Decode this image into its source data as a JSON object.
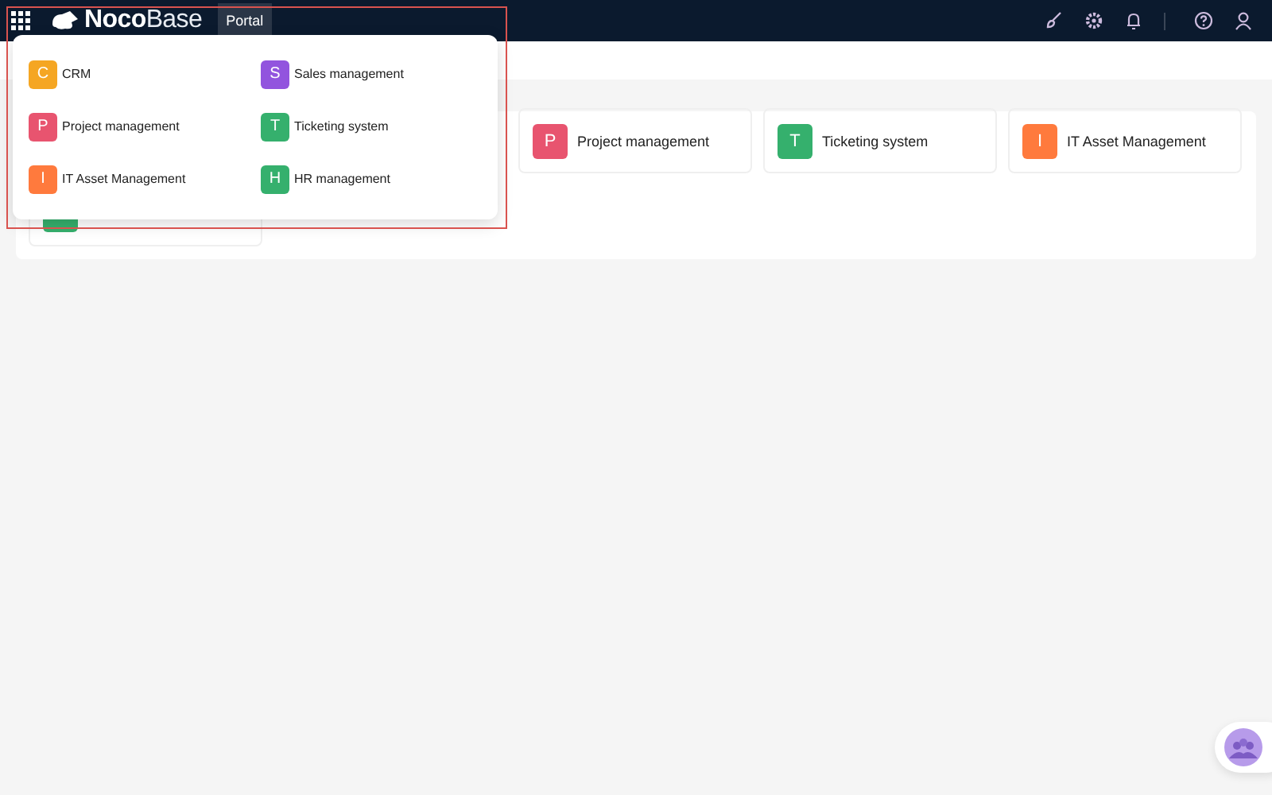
{
  "header": {
    "logo": {
      "bold": "Noco",
      "light": "Base"
    },
    "tabs": [
      {
        "label": "Portal",
        "selected": true
      }
    ]
  },
  "app_menu": {
    "items": [
      {
        "letter": "C",
        "label": "CRM",
        "color": "#f5a623"
      },
      {
        "letter": "S",
        "label": "Sales management",
        "color": "#9254de"
      },
      {
        "letter": "P",
        "label": "Project management",
        "color": "#e8546f"
      },
      {
        "letter": "T",
        "label": "Ticketing system",
        "color": "#35b06d"
      },
      {
        "letter": "I",
        "label": "IT Asset Management",
        "color": "#ff7a3d"
      },
      {
        "letter": "H",
        "label": "HR management",
        "color": "#35b06d"
      }
    ]
  },
  "portal": {
    "tiles": [
      {
        "letter": "P",
        "label": "Project management",
        "color": "#e8546f"
      },
      {
        "letter": "T",
        "label": "Ticketing system",
        "color": "#35b06d"
      },
      {
        "letter": "I",
        "label": "IT Asset Management",
        "color": "#ff7a3d"
      },
      {
        "color": "#35b06d"
      }
    ]
  }
}
